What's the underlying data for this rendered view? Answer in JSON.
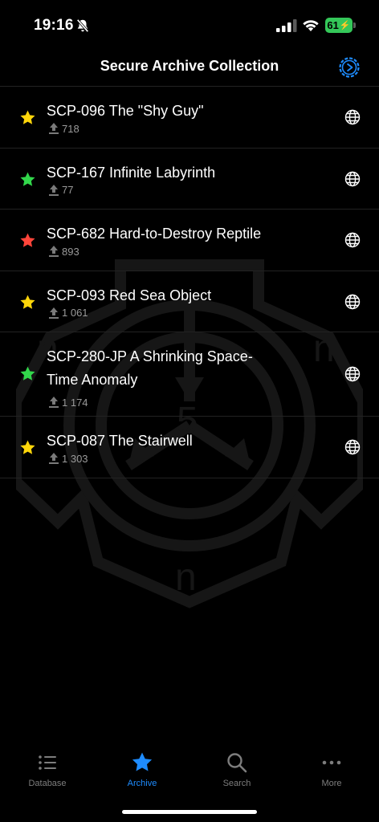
{
  "status": {
    "time": "19:16",
    "battery": "61"
  },
  "header": {
    "title": "Secure Archive Collection",
    "settings_icon": "gear-icon"
  },
  "colors": {
    "yellow": "#ffd60a",
    "green": "#32d74b",
    "red": "#ff453a",
    "accent": "#1e8cff"
  },
  "items": [
    {
      "title": "SCP-096 The \"Shy Guy\"",
      "rating": "718",
      "star_color": "yellow"
    },
    {
      "title": "SCP-167 Infinite Labyrinth",
      "rating": "77",
      "star_color": "green"
    },
    {
      "title": "SCP-682 Hard-to-Destroy Reptile",
      "rating": "893",
      "star_color": "red"
    },
    {
      "title": "SCP-093 Red Sea Object",
      "rating": "1 061",
      "star_color": "yellow"
    },
    {
      "title": "SCP-280-JP A Shrinking Space-Time Anomaly",
      "rating": "1 174",
      "star_color": "green"
    },
    {
      "title": "SCP-087 The Stairwell",
      "rating": "1 303",
      "star_color": "yellow"
    }
  ],
  "tabs": [
    {
      "label": "Database",
      "icon": "list-icon",
      "active": false
    },
    {
      "label": "Archive",
      "icon": "star-icon",
      "active": true
    },
    {
      "label": "Search",
      "icon": "search-icon",
      "active": false
    },
    {
      "label": "More",
      "icon": "more-icon",
      "active": false
    }
  ]
}
